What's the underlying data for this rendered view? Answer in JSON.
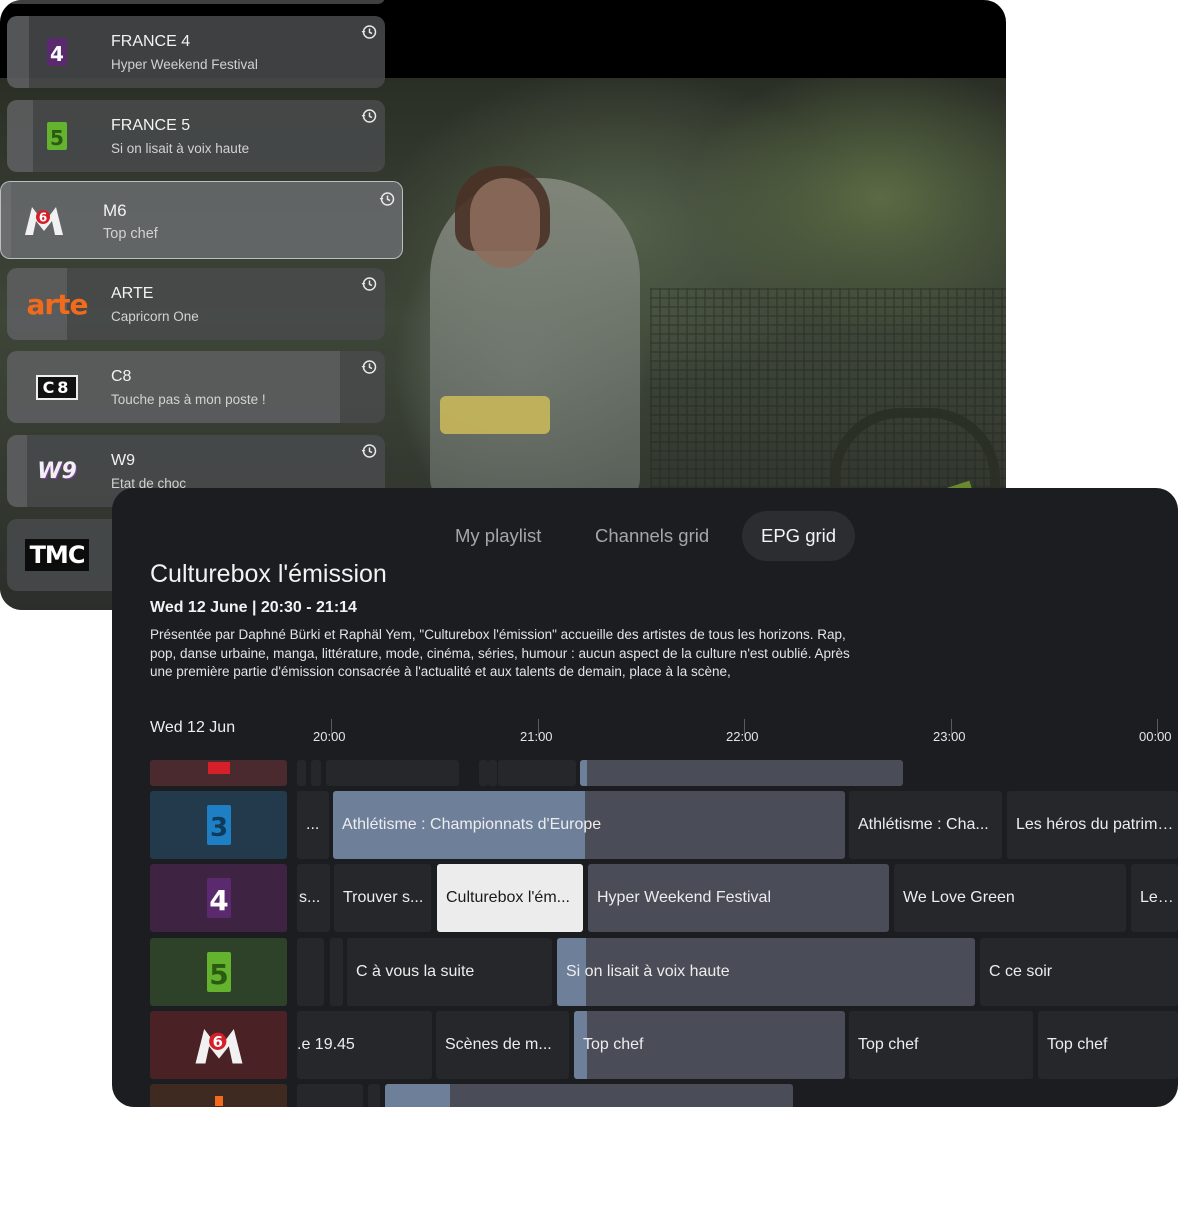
{
  "live_panel": {
    "channels": [
      {
        "name": "FRANCE 4",
        "program": "Hyper Weekend Festival",
        "logo": "france4-logo"
      },
      {
        "name": "FRANCE 5",
        "program": "Si on lisait à voix haute",
        "logo": "france5-logo"
      },
      {
        "name": "M6",
        "program": "Top chef",
        "logo": "m6-logo",
        "focused": true
      },
      {
        "name": "ARTE",
        "program": "Capricorn One",
        "logo": "arte-logo"
      },
      {
        "name": "C8",
        "program": "Touche pas à mon poste !",
        "logo": "c8-logo"
      },
      {
        "name": "W9",
        "program": "Etat de choc",
        "logo": "w9-logo"
      },
      {
        "name": "",
        "program": "",
        "logo": "tmc-logo"
      }
    ],
    "logo_text": {
      "arte": "arte",
      "tmc": "TMC",
      "w9": "W9",
      "c8": "C8"
    }
  },
  "epg": {
    "tabs": [
      "My playlist",
      "Channels grid",
      "EPG grid"
    ],
    "active_tab": "EPG grid",
    "selected_program": {
      "title": "Culturebox l'émission",
      "meta": "Wed 12 June | 20:30 - 21:14",
      "description": "Présentée par Daphné Bürki et Raphäl Yem, \"Culturebox l'émission\" accueille des artistes de tous les horizons. Rap, pop, danse urbaine, manga, littérature, mode, cinéma, séries, humour : aucun aspect de la culture n'est oublié. Après une première partie d'émission consacrée à l'actualité et aux talents de demain, place à la scène,"
    },
    "date": "Wed 12 Jun",
    "times": [
      "20:00",
      "21:00",
      "22:00",
      "23:00",
      "00:00"
    ],
    "rows": {
      "france3": [
        "...",
        "Athlétisme : Championnats d'Europe",
        "Athlétisme : Cha...",
        "Les héros du patrimoi..."
      ],
      "france4": [
        "s...",
        "Trouver s...",
        "Culturebox l'ém...",
        "Hyper Weekend Festival",
        "We Love Green",
        "Les V"
      ],
      "france5": [
        "C à vous la suite",
        "Si on lisait à voix haute",
        "C ce soir"
      ],
      "m6": [
        ".e 19.45",
        "Scènes de m...",
        "Top chef",
        "Top chef",
        "Top chef"
      ]
    }
  },
  "colors": {
    "panel_bg": "#1c1d21",
    "cell_bg": "#26272b",
    "current_cell_bg": "#4a4c57",
    "selected_cell_bg": "#ececec",
    "france4_purple": "#5b2a6e",
    "france5_green": "#63b32e",
    "m6_red": "#d5202a",
    "arte_orange": "#f26b1d"
  }
}
